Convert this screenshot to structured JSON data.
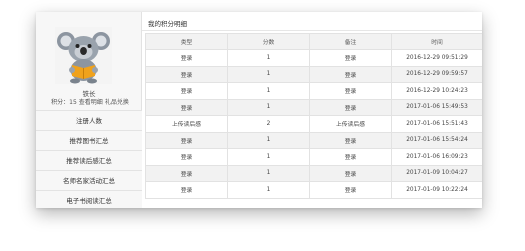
{
  "user": {
    "name": "铁长",
    "points_label": "积分：15",
    "link_details": "查看明细",
    "link_exchange": "礼品兑换"
  },
  "nav": {
    "items": [
      {
        "label": "注册人数"
      },
      {
        "label": "推荐图书汇总"
      },
      {
        "label": "推荐读后感汇总"
      },
      {
        "label": "名师名家活动汇总"
      },
      {
        "label": "电子书阅读汇总"
      }
    ]
  },
  "main": {
    "title": "我的积分明细",
    "columns": [
      "类型",
      "分数",
      "备注",
      "时间"
    ],
    "rows": [
      {
        "type": "登录",
        "score": "1",
        "note": "登录",
        "time": "2016-12-29 09:51:29"
      },
      {
        "type": "登录",
        "score": "1",
        "note": "登录",
        "time": "2016-12-29 09:59:57"
      },
      {
        "type": "登录",
        "score": "1",
        "note": "登录",
        "time": "2016-12-29 10:24:23"
      },
      {
        "type": "登录",
        "score": "1",
        "note": "登录",
        "time": "2017-01-06 15:49:53"
      },
      {
        "type": "上传读后感",
        "score": "2",
        "note": "上传读后感",
        "time": "2017-01-06 15:51:43"
      },
      {
        "type": "登录",
        "score": "1",
        "note": "登录",
        "time": "2017-01-06 15:54:24"
      },
      {
        "type": "登录",
        "score": "1",
        "note": "登录",
        "time": "2017-01-06 16:09:23"
      },
      {
        "type": "登录",
        "score": "1",
        "note": "登录",
        "time": "2017-01-09 10:04:27"
      },
      {
        "type": "登录",
        "score": "1",
        "note": "登录",
        "time": "2017-01-09 10:22:24"
      }
    ]
  },
  "colors": {
    "header_bg": "#f2f2f2",
    "row_alt_bg": "#f2f2f2",
    "border": "#e2e2e2",
    "sidebar_bg": "#f7f7f7"
  }
}
